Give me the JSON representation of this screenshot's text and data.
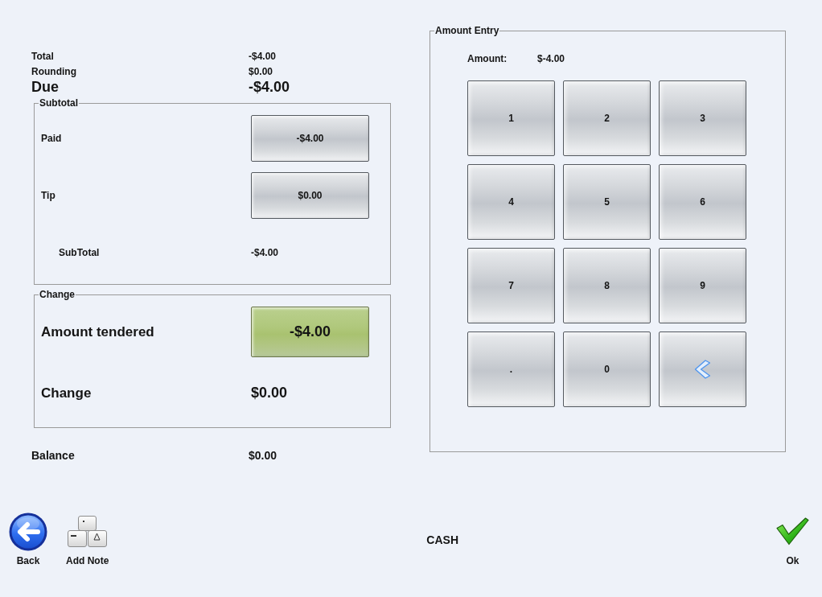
{
  "summary": [
    {
      "label": "Total",
      "value": "-$4.00",
      "kind": "normal"
    },
    {
      "label": "Rounding",
      "value": "$0.00",
      "kind": "normal"
    },
    {
      "label": "Due",
      "value": "-$4.00",
      "kind": "large"
    }
  ],
  "subtotal_panel": {
    "title": "Subtotal",
    "rows": [
      {
        "label": "Paid",
        "value": "-$4.00",
        "kind": "button",
        "selected": false
      },
      {
        "label": "Tip",
        "value": "$0.00",
        "kind": "button",
        "selected": false
      },
      {
        "label": "SubTotal",
        "value": "-$4.00",
        "kind": "text"
      }
    ]
  },
  "change_panel": {
    "title": "Change",
    "rows": [
      {
        "label": "Amount tendered",
        "value": "-$4.00",
        "kind": "button",
        "selected": true
      },
      {
        "label": "Change",
        "value": "$0.00",
        "kind": "text"
      }
    ]
  },
  "balance": {
    "label": "Balance",
    "value": "$0.00"
  },
  "amount_entry": {
    "title": "Amount Entry",
    "label": "Amount:",
    "value": "$-4.00",
    "keys": [
      {
        "label": "1",
        "kind": "digit"
      },
      {
        "label": "2",
        "kind": "digit"
      },
      {
        "label": "3",
        "kind": "digit"
      },
      {
        "label": "4",
        "kind": "digit"
      },
      {
        "label": "5",
        "kind": "digit"
      },
      {
        "label": "6",
        "kind": "digit"
      },
      {
        "label": "7",
        "kind": "digit"
      },
      {
        "label": "8",
        "kind": "digit"
      },
      {
        "label": "9",
        "kind": "digit"
      },
      {
        "label": ".",
        "kind": "digit"
      },
      {
        "label": "0",
        "kind": "digit"
      },
      {
        "kind": "backspace"
      }
    ]
  },
  "footer": {
    "buttons": [
      {
        "label": "Back",
        "kind": "back"
      },
      {
        "label": "Add Note",
        "kind": "note"
      }
    ],
    "tender_type": "CASH",
    "ok_button": {
      "label": "Ok"
    }
  }
}
